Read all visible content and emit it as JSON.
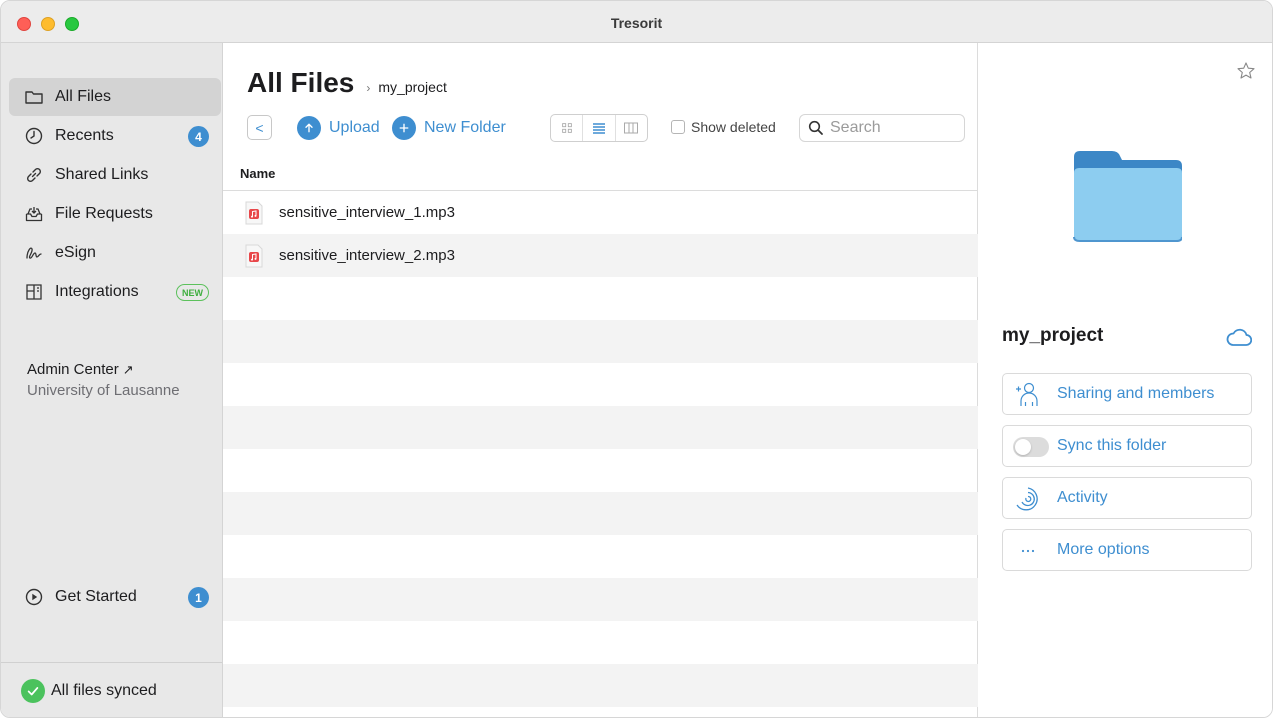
{
  "window": {
    "title": "Tresorit"
  },
  "sidebar": {
    "items": [
      {
        "label": "All Files",
        "icon": "folder-icon"
      },
      {
        "label": "Recents",
        "icon": "clock-icon",
        "badge": "4"
      },
      {
        "label": "Shared Links",
        "icon": "link-icon"
      },
      {
        "label": "File Requests",
        "icon": "inbox-icon"
      },
      {
        "label": "eSign",
        "icon": "signature-icon"
      },
      {
        "label": "Integrations",
        "icon": "integrations-icon",
        "badge": "NEW"
      }
    ],
    "admin_label": "Admin Center",
    "organization": "University of Lausanne",
    "get_started": {
      "label": "Get Started",
      "badge": "1"
    },
    "sync_status": "All files synced"
  },
  "main": {
    "title": "All Files",
    "breadcrumb_separator": "›",
    "breadcrumb": "my_project",
    "toolbar": {
      "back_glyph": "<",
      "upload_label": "Upload",
      "new_folder_label": "New Folder",
      "show_deleted_label": "Show deleted",
      "search_placeholder": "Search"
    },
    "column_name": "Name",
    "files": [
      {
        "name": "sensitive_interview_1.mp3"
      },
      {
        "name": "sensitive_interview_2.mp3"
      }
    ]
  },
  "details": {
    "folder_name": "my_project",
    "options": {
      "sharing": "Sharing and members",
      "sync": "Sync this folder",
      "activity": "Activity",
      "more": "More options"
    }
  },
  "colors": {
    "accent": "#3e8ed0",
    "success": "#4bc25d",
    "mp3": "#e8474a"
  }
}
